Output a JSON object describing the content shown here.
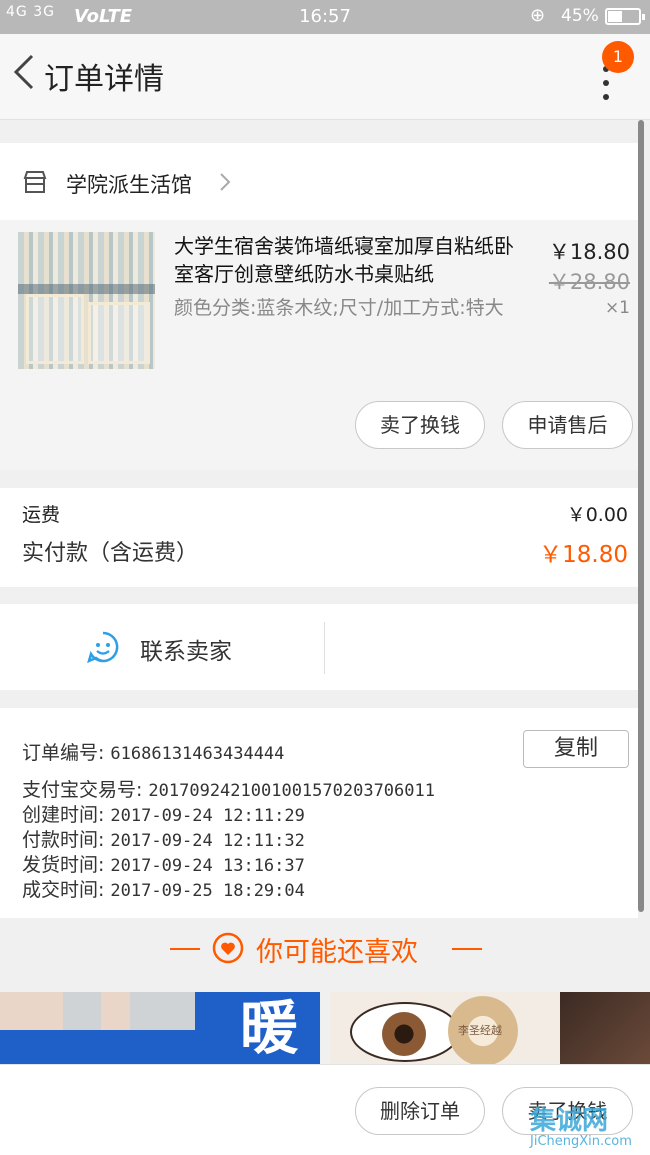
{
  "status_bar": {
    "signal": "4G 3G",
    "network": "VoLTE",
    "time": "16:57",
    "battery": "45%"
  },
  "nav": {
    "title": "订单详情",
    "badge_count": "1"
  },
  "shop": {
    "name": "学院派生活馆"
  },
  "product": {
    "title": "大学生宿舍装饰墙纸寝室加厚自粘纸卧室客厅创意壁纸防水书桌贴纸",
    "attributes": "颜色分类:蓝条木纹;尺寸/加工方式:特大",
    "price": "￥18.80",
    "original_price": "￥28.80",
    "quantity": "×1",
    "actions": [
      "卖了换钱",
      "申请售后"
    ]
  },
  "fees": {
    "shipping_label": "运费",
    "shipping_value": "￥0.00",
    "paid_label": "实付款（含运费）",
    "paid_value": "￥18.80"
  },
  "contact": {
    "label": "联系卖家"
  },
  "order_info": {
    "copy_label": "复制",
    "rows": [
      {
        "label": "订单编号:",
        "value": "61686131463434444"
      },
      {
        "label": "支付宝交易号:",
        "value": "2017092421001001570203706011"
      },
      {
        "label": "创建时间:",
        "value": "2017-09-24 12:11:29"
      },
      {
        "label": "付款时间:",
        "value": "2017-09-24 12:11:32"
      },
      {
        "label": "发货时间:",
        "value": "2017-09-24 13:16:37"
      },
      {
        "label": "成交时间:",
        "value": "2017-09-25 18:29:04"
      }
    ]
  },
  "recommend": {
    "title": "你可能还喜欢",
    "banner_left_text": "暖",
    "banner_right_text": "李圣经越"
  },
  "bottom_actions": [
    "删除订单",
    "卖了换钱"
  ],
  "watermark": {
    "big": "集诚网",
    "small": "JiChengXin.com"
  },
  "colors": {
    "accent": "#ff5a00",
    "badge": "#ff5a00",
    "contact_icon": "#2d9fe8",
    "status_bar": "#b8b8b8"
  }
}
